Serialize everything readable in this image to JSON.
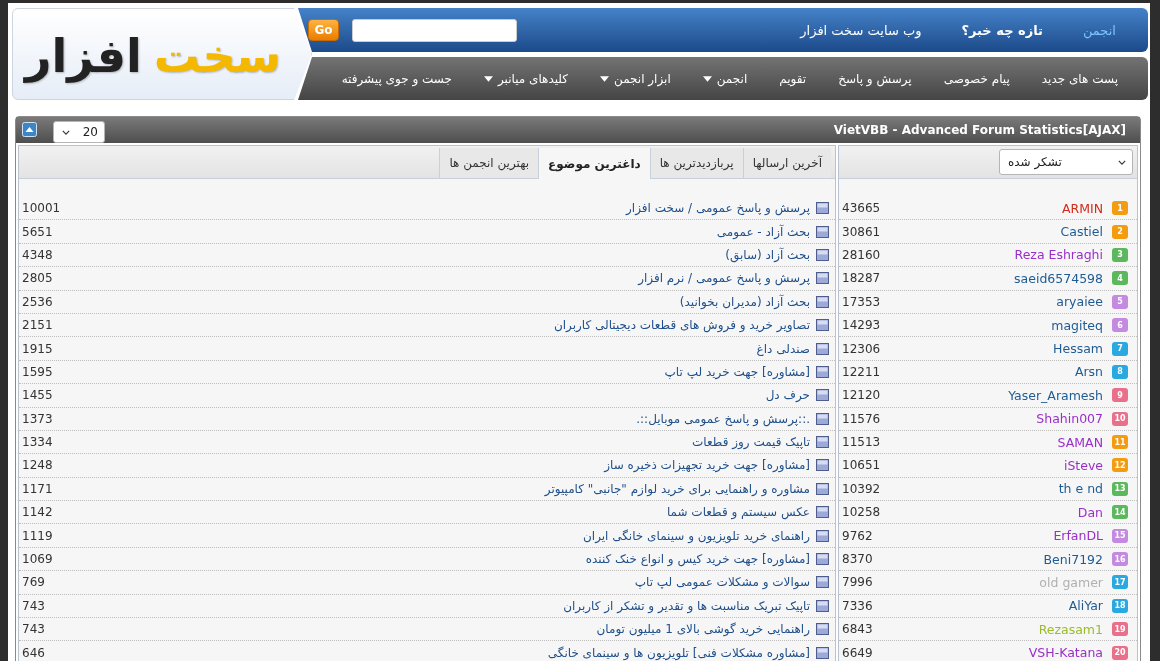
{
  "logo": {
    "accent": "سخت",
    "text": "افزار"
  },
  "top_tabs": [
    {
      "label": "انجمن",
      "selected": true,
      "highlighted": false
    },
    {
      "label": "تازه چه خبر؟",
      "selected": false,
      "highlighted": true
    },
    {
      "label": "وب سایت سخت افزار",
      "selected": false,
      "highlighted": false
    }
  ],
  "search": {
    "button": "Go"
  },
  "nav": [
    {
      "label": "پست های جدید",
      "dropdown": false
    },
    {
      "label": "پیام خصوصی",
      "dropdown": false
    },
    {
      "label": "پرسش و پاسخ",
      "dropdown": false
    },
    {
      "label": "تقویم",
      "dropdown": false
    },
    {
      "label": "انجمن",
      "dropdown": true
    },
    {
      "label": "ابزار انجمن",
      "dropdown": true
    },
    {
      "label": "کلیدهای میانبر",
      "dropdown": true
    },
    {
      "label": "جست و جوی پیشرفته",
      "dropdown": false
    }
  ],
  "stats": {
    "title": "VietVBB - Advanced Forum Statistics[AJAX]",
    "page_size": "20",
    "threads": {
      "tabs": [
        {
          "label": "آخرین ارسالها",
          "selected": false
        },
        {
          "label": "پربازدیدترین ها",
          "selected": false
        },
        {
          "label": "داغترین موضوع",
          "selected": true
        },
        {
          "label": "بهترین انجمن ها",
          "selected": false
        }
      ],
      "rows": [
        {
          "title": "پرسش و پاسخ عمومی / سخت افزار",
          "count": "10001"
        },
        {
          "title": "بحث آزاد - عمومی",
          "count": "5651"
        },
        {
          "title": "بحث آزاد (سابق)",
          "count": "4348"
        },
        {
          "title": "پرسش و پاسخ عمومی / نرم افزار",
          "count": "2805"
        },
        {
          "title": "بحث آزاد (مدیران بخوانید)",
          "count": "2536"
        },
        {
          "title": "تصاویر خرید و فروش های قطعات دیجیتالی کاربران",
          "count": "2151"
        },
        {
          "title": "صندلی داغ",
          "count": "1915"
        },
        {
          "title": "[مشاوره] جهت خرید لپ تاپ",
          "count": "1595"
        },
        {
          "title": "حرف دل",
          "count": "1455"
        },
        {
          "title": ".::پرسش و پاسخ عمومی موبایل::.",
          "count": "1373"
        },
        {
          "title": "تاپیک قیمت روز قطعات",
          "count": "1334"
        },
        {
          "title": "[مشاوره] جهت خرید تجهیزات ذخیره ساز",
          "count": "1248"
        },
        {
          "title": "مشاوره و راهنمایی برای خرید لوازم \"جانبی\" کامپیوتر",
          "count": "1171"
        },
        {
          "title": "عکس سیستم و قطعات شما",
          "count": "1142"
        },
        {
          "title": "راهنمای خرید تلویزیون و سینمای خانگی ایران",
          "count": "1119"
        },
        {
          "title": "[مشاوره] جهت خرید کیس و انواع خنک کننده",
          "count": "1069"
        },
        {
          "title": "سوالات و مشکلات عمومی لپ تاپ",
          "count": "769"
        },
        {
          "title": "تاپیک تبریک مناسبت ها و تقدیر و تشکر از کاربران",
          "count": "743"
        },
        {
          "title": "راهنمایی خرید گوشی بالای 1 میلیون تومان",
          "count": "743"
        },
        {
          "title": "[مشاوره مشکلات فنی] تلویزیون ها و سینمای خانگی",
          "count": "646"
        }
      ]
    },
    "users": {
      "filter": "تشکر شده",
      "rows": [
        {
          "count": "43665",
          "user": {
            "name": "ARMIN",
            "color": "#d42a1a"
          },
          "badge": {
            "rank": "1",
            "color": "#f39c12"
          }
        },
        {
          "count": "30861",
          "user": {
            "name": "Castiel",
            "color": "#1f5b94"
          },
          "badge": {
            "rank": "2",
            "color": "#f39c12"
          }
        },
        {
          "count": "28160",
          "user": {
            "name": "Reza Eshraghi",
            "color": "#9a2fc8"
          },
          "badge": {
            "rank": "3",
            "color": "#5cb85c"
          }
        },
        {
          "count": "18287",
          "user": {
            "name": "saeid6574598",
            "color": "#1f5b94"
          },
          "badge": {
            "rank": "4",
            "color": "#5cb85c"
          }
        },
        {
          "count": "17353",
          "user": {
            "name": "aryaiee",
            "color": "#1f5b94"
          },
          "badge": {
            "rank": "5",
            "color": "#c38ae0"
          }
        },
        {
          "count": "14293",
          "user": {
            "name": "magiteq",
            "color": "#1f5b94"
          },
          "badge": {
            "rank": "6",
            "color": "#c38ae0"
          }
        },
        {
          "count": "12306",
          "user": {
            "name": "Hessam",
            "color": "#1f5b94"
          },
          "badge": {
            "rank": "7",
            "color": "#2aa8e0"
          }
        },
        {
          "count": "12211",
          "user": {
            "name": "Arsn",
            "color": "#1f5b94"
          },
          "badge": {
            "rank": "8",
            "color": "#2aa8e0"
          }
        },
        {
          "count": "12120",
          "user": {
            "name": "Yaser_Aramesh",
            "color": "#1f5b94"
          },
          "badge": {
            "rank": "9",
            "color": "#e8708a"
          }
        },
        {
          "count": "11576",
          "user": {
            "name": "Shahin007",
            "color": "#9a2fc8"
          },
          "badge": {
            "rank": "10",
            "color": "#e8708a"
          }
        },
        {
          "count": "11513",
          "user": {
            "name": "SAMAN",
            "color": "#9a2fc8"
          },
          "badge": {
            "rank": "11",
            "color": "#f39c12"
          }
        },
        {
          "count": "10651",
          "user": {
            "name": "iSteve",
            "color": "#9a2fc8"
          },
          "badge": {
            "rank": "12",
            "color": "#f39c12"
          }
        },
        {
          "count": "10392",
          "user": {
            "name": "th e nd",
            "color": "#1f5b94"
          },
          "badge": {
            "rank": "13",
            "color": "#5cb85c"
          }
        },
        {
          "count": "10258",
          "user": {
            "name": "Dan",
            "color": "#9a2fc8"
          },
          "badge": {
            "rank": "14",
            "color": "#5cb85c"
          }
        },
        {
          "count": "9762",
          "user": {
            "name": "ErfanDL",
            "color": "#9a2fc8"
          },
          "badge": {
            "rank": "15",
            "color": "#c38ae0"
          }
        },
        {
          "count": "8370",
          "user": {
            "name": "Beni7192",
            "color": "#1f5b94"
          },
          "badge": {
            "rank": "16",
            "color": "#c38ae0"
          }
        },
        {
          "count": "7996",
          "user": {
            "name": "old gamer",
            "color": "#b0b0b0"
          },
          "badge": {
            "rank": "17",
            "color": "#2aa8e0"
          }
        },
        {
          "count": "7336",
          "user": {
            "name": "AliYar",
            "color": "#1f5b94"
          },
          "badge": {
            "rank": "18",
            "color": "#2aa8e0"
          }
        },
        {
          "count": "6843",
          "user": {
            "name": "Rezasam1",
            "color": "#9cba2c"
          },
          "badge": {
            "rank": "19",
            "color": "#e8708a"
          }
        },
        {
          "count": "6649",
          "user": {
            "name": "VSH-Katana",
            "color": "#9a2fc8"
          },
          "badge": {
            "rank": "20",
            "color": "#e8708a"
          }
        }
      ]
    }
  }
}
